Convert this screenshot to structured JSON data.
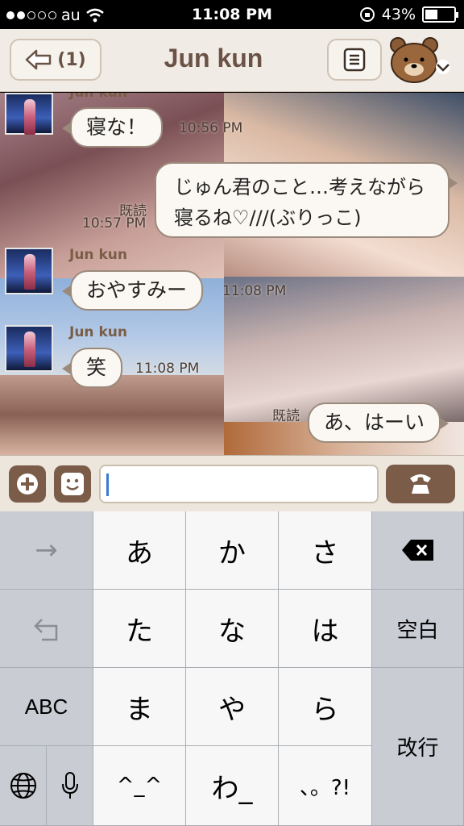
{
  "status_bar": {
    "carrier": "au",
    "time": "11:08 PM",
    "battery_percent": "43%",
    "battery_level": 0.43,
    "signal_icon": "signal-dots-icon",
    "wifi_icon": "wifi-icon",
    "rotation_lock_icon": "rotation-lock-icon"
  },
  "header": {
    "back_label": "(1)",
    "title": "Jun kun",
    "menu_icon": "menu-list-icon",
    "avatar_icon": "brown-bear-avatar-icon",
    "dropdown_icon": "chevron-down-icon"
  },
  "chat": {
    "messages": [
      {
        "sender": "Jun kun",
        "text": "寝な！",
        "time": "10:56 PM",
        "side": "left"
      },
      {
        "text": "じゅん君のこと…考えながら寝るね♡///(ぶりっこ)",
        "time": "10:57 PM",
        "read": "既読",
        "side": "right"
      },
      {
        "sender": "Jun kun",
        "text": "おやすみー",
        "time": "11:08 PM",
        "side": "left"
      },
      {
        "sender": "Jun kun",
        "text": "笑",
        "time": "11:08 PM",
        "side": "left"
      },
      {
        "text": "あ、はーい",
        "read": "既読",
        "side": "right"
      }
    ]
  },
  "input_bar": {
    "plus_icon": "plus-icon",
    "sticker_icon": "smiley-icon",
    "input_value": "",
    "call_icon": "phone-icon"
  },
  "keyboard": {
    "rows": [
      [
        "→",
        "あ",
        "か",
        "さ",
        "⌫"
      ],
      [
        "↺",
        "た",
        "な",
        "は",
        "空白"
      ],
      [
        "ABC",
        "ま",
        "や",
        "ら",
        "改行"
      ],
      [
        "globe",
        "mic",
        "^_^",
        "わ_",
        "、。?!"
      ]
    ],
    "labels": {
      "arrow": "→",
      "a": "あ",
      "ka": "か",
      "sa": "さ",
      "ta": "た",
      "na": "な",
      "ha": "は",
      "space": "空白",
      "abc": "ABC",
      "ma": "ま",
      "ya": "や",
      "ra": "ら",
      "enter": "改行",
      "emoticon": "^_^",
      "wa": "わ_",
      "punct": "、。?!"
    }
  }
}
